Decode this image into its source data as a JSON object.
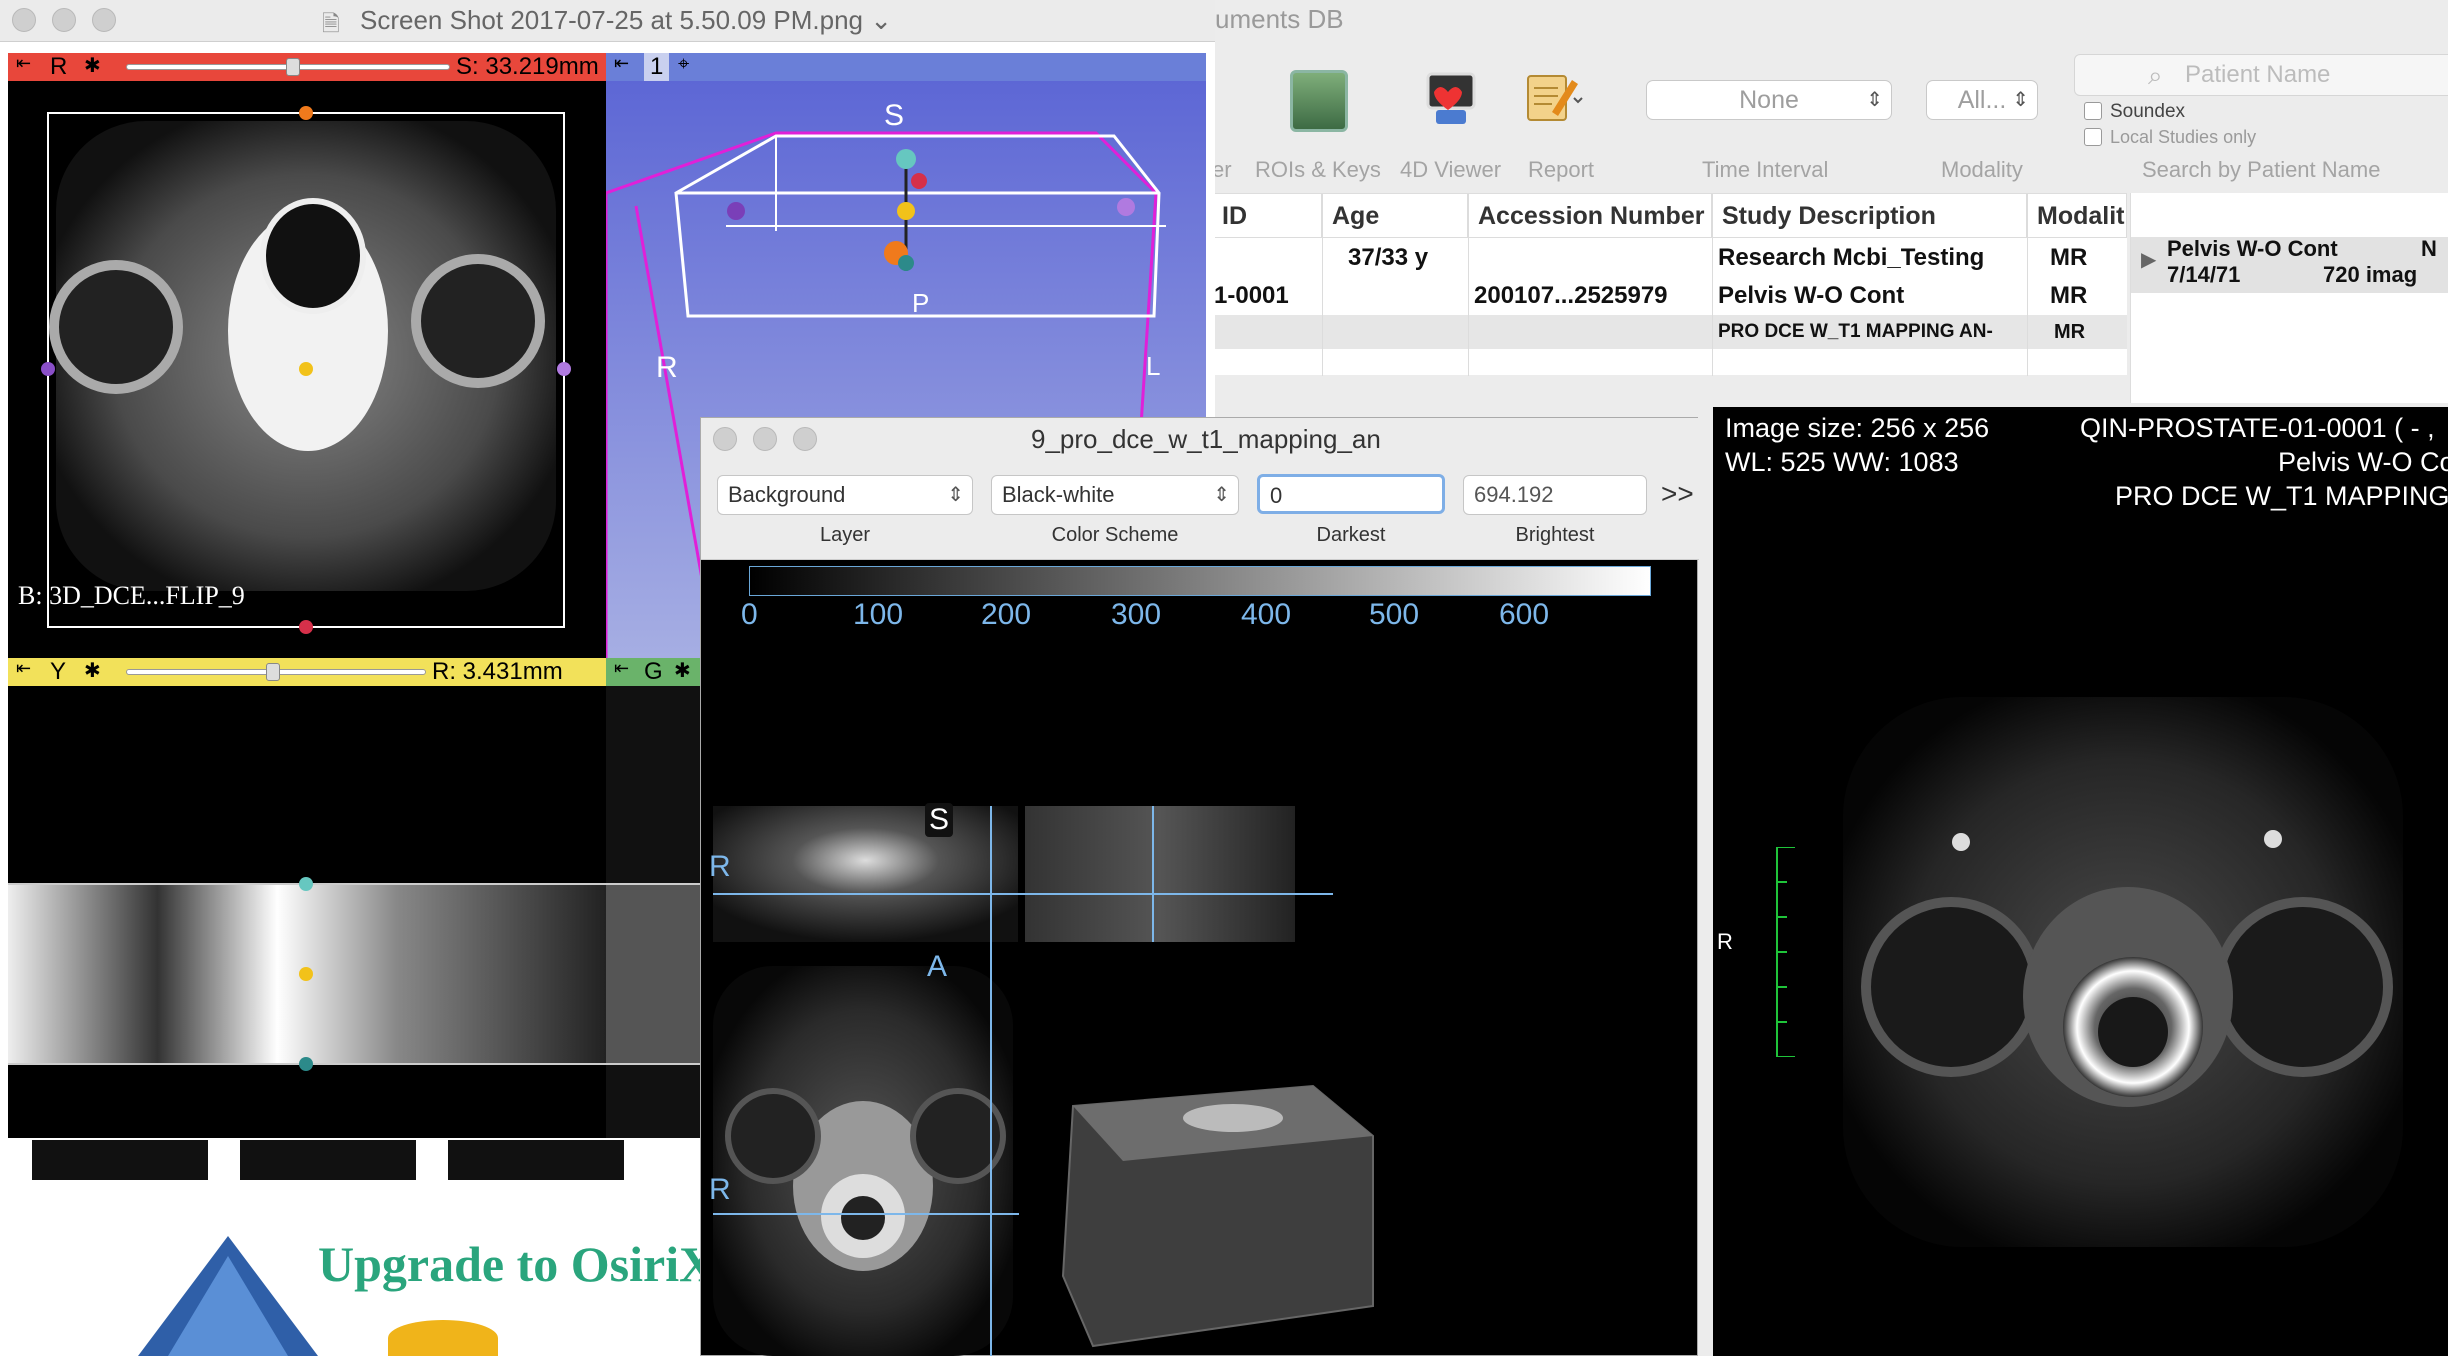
{
  "browser": {
    "title_partial": "uments DB",
    "toolbar": {
      "partial_label": "er",
      "rois_label": "ROIs & Keys",
      "viewer_label": "4D Viewer",
      "report_label": "Report",
      "interval_label": "Time Interval",
      "modality_label": "Modality",
      "search_label": "Search by Patient Name"
    },
    "interval_value": "None",
    "modality_value": "All...",
    "search_placeholder": "Patient Name",
    "soundex_label": "Soundex",
    "local_label": "Local Studies only",
    "table": {
      "headers": [
        "ID",
        "Age",
        "Accession Number",
        "Study Description",
        "Modalit"
      ],
      "rows": [
        {
          "id": "",
          "age": "37/33 y",
          "accession": "",
          "description": "Research Mcbi_Testing",
          "modality": "MR"
        },
        {
          "id": "1-0001",
          "age": "",
          "accession": "200107...2525979",
          "description": "Pelvis W-O Cont",
          "modality": "MR"
        },
        {
          "id": "",
          "age": "",
          "accession": "",
          "description": "PRO DCE W_T1 MAPPING AN-",
          "modality": "MR"
        }
      ]
    },
    "series": {
      "name": "Pelvis W-O Cont",
      "date": "7/14/71",
      "count": "720 imag",
      "extra": "N"
    }
  },
  "dicom": {
    "image_size": "Image size: 256 x 256",
    "window": "WL: 525 WW: 1083",
    "patient": "QIN-PROSTATE-01-0001 ( - ,",
    "study": "Pelvis W-O Co",
    "series": "PRO DCE W_T1 MAPPING A",
    "orient": "R"
  },
  "slicer": {
    "window_title": "Screen Shot 2017-07-25 at 5.50.09 PM.png",
    "red": {
      "letter": "R",
      "offset": "S: 33.219mm",
      "bg_label": "B: 3D_DCE...FLIP_9"
    },
    "blue": {
      "letter": "1",
      "orient_s": "S",
      "orient_p": "P",
      "orient_r": "R",
      "orient_l": "L"
    },
    "yellow": {
      "letter": "Y",
      "offset": "R: 3.431mm"
    },
    "green": {
      "letter": "G"
    },
    "promo": "Upgrade to OsiriX"
  },
  "volume_dialog": {
    "title": "9_pro_dce_w_t1_mapping_an",
    "layer_value": "Background",
    "scheme_value": "Black-white",
    "darkest_value": "0",
    "brightest_value": "694.192",
    "layer_caption": "Layer",
    "scheme_caption": "Color Scheme",
    "darkest_caption": "Darkest",
    "brightest_caption": "Brightest",
    "more": ">>",
    "ticks": [
      "0",
      "100",
      "200",
      "300",
      "400",
      "500",
      "600"
    ],
    "labels": {
      "s": "S",
      "r1": "R",
      "a": "A",
      "r2": "R"
    }
  },
  "colors": {
    "red_bar": "#e8473b",
    "yellow_bar": "#f2e15a",
    "blue_bar": "#6a7fd8",
    "green_bar": "#6ab36a",
    "accent": "#7db7ea"
  }
}
